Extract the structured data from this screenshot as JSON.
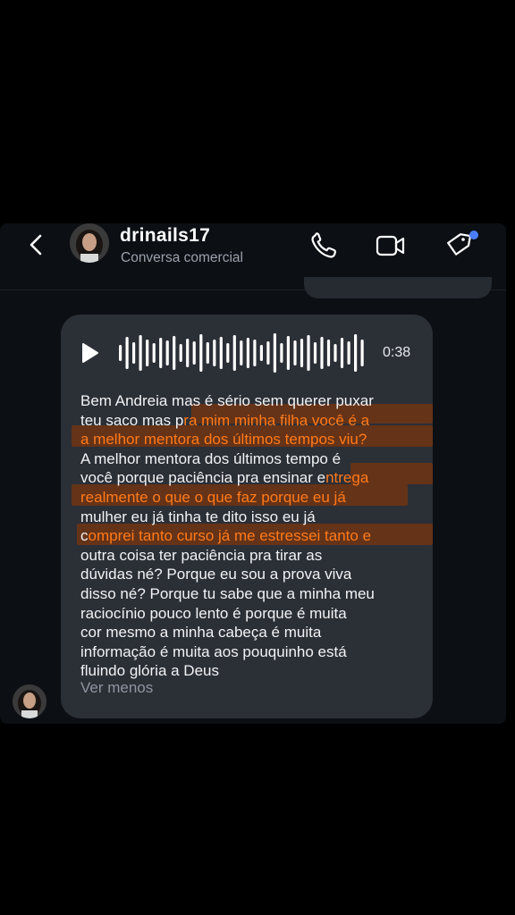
{
  "header": {
    "username": "drinails17",
    "subtitle": "Conversa comercial"
  },
  "audio": {
    "duration": "0:38"
  },
  "message": {
    "segments": [
      {
        "text": "Bem Andreia mas é sério sem querer puxar\nteu saco mas p",
        "highlight": false
      },
      {
        "text": "ra mim minha filha você é a\na melhor mentora dos últimos tempos viu?",
        "highlight": true
      },
      {
        "text": "\nA melhor mentora dos últimos tempo é\nvocê porque paciência pra ensinar e",
        "highlight": false
      },
      {
        "text": "ntrega\nrealmente o que o que faz porque eu já",
        "highlight": true
      },
      {
        "text": "\nmulher eu já tinha te dito isso eu já\nc",
        "highlight": false
      },
      {
        "text": "omprei tanto curso já me estressei tanto e",
        "highlight": true
      },
      {
        "text": "\noutra coisa ter paciência pra tirar as\ndúvidas né? Porque eu sou a prova viva\ndisso né? Porque tu sabe que a minha meu\nraciocínio pouco lento é porque é muita\ncor mesmo a minha cabeça é muita\ninformação é muita aos pouquinho está\nfluindo glória a Deus",
        "highlight": false
      }
    ],
    "see_less": "Ver menos"
  },
  "colors": {
    "background": "#000000",
    "chat_bg": "#0c0f14",
    "bubble": "#2b2f36",
    "highlight_text": "#ff7a1a",
    "badge": "#4a7dff"
  },
  "icons": [
    "back-arrow-icon",
    "phone-icon",
    "video-camera-icon",
    "tag-icon",
    "play-icon",
    "waveform-icon"
  ]
}
